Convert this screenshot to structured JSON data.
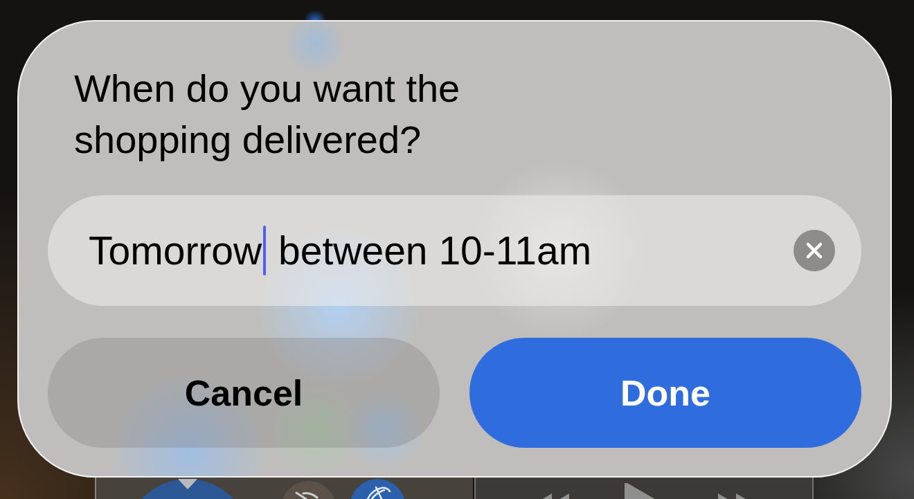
{
  "dialog": {
    "title": "When do you want the shopping delivered?",
    "field": {
      "text_before_caret": "Tomorrow",
      "text_after_caret": " between 10-11am",
      "focused": true
    },
    "buttons": [
      {
        "label": "Cancel",
        "kind": "secondary"
      },
      {
        "label": "Done",
        "kind": "primary"
      }
    ]
  }
}
